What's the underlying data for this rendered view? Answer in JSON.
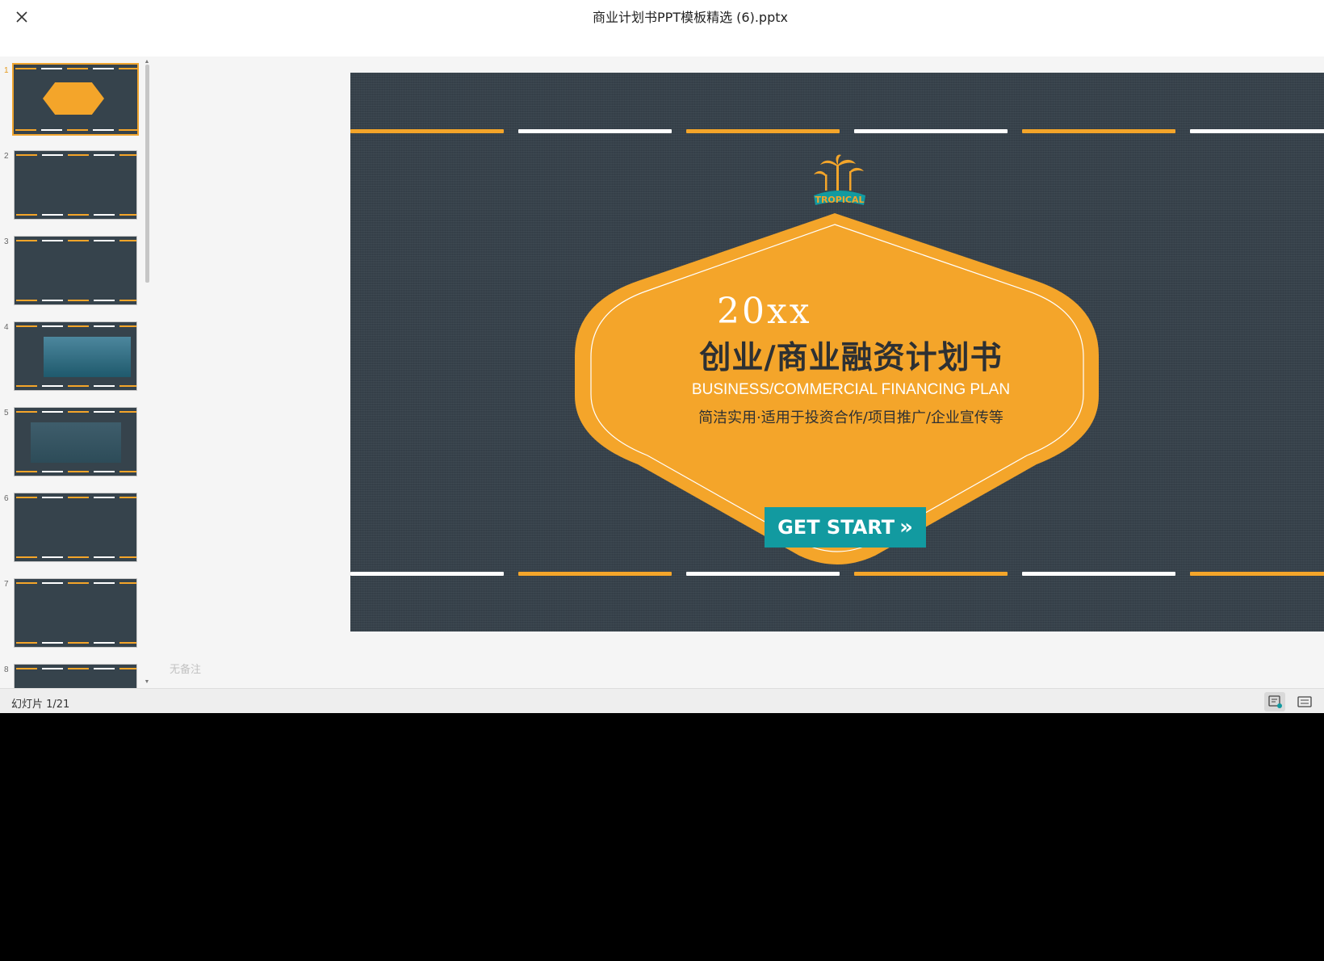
{
  "window": {
    "title": "商业计划书PPT模板精选 (6).pptx",
    "close_icon": "close-icon"
  },
  "thumbnails": [
    {
      "number": "1",
      "active": true
    },
    {
      "number": "2",
      "active": false
    },
    {
      "number": "3",
      "active": false
    },
    {
      "number": "4",
      "active": false
    },
    {
      "number": "5",
      "active": false
    },
    {
      "number": "6",
      "active": false
    },
    {
      "number": "7",
      "active": false
    },
    {
      "number": "8",
      "active": false
    }
  ],
  "slide": {
    "year": "20xx",
    "title": "创业/商业融资计划书",
    "subtitle_en": "BUSINESS/COMMERCIAL FINANCING PLAN",
    "subtitle_cn": "简洁实用·适用于投资合作/项目推广/企业宣传等",
    "button_label": "GET START",
    "logo_text": "TROPICAL",
    "colors": {
      "background": "#37424b",
      "accent": "#f4a52a",
      "button": "#129aa0",
      "dash_white": "#ffffff"
    }
  },
  "notes": {
    "placeholder": "无备注"
  },
  "status": {
    "slide_counter": "幻灯片 1/21"
  }
}
